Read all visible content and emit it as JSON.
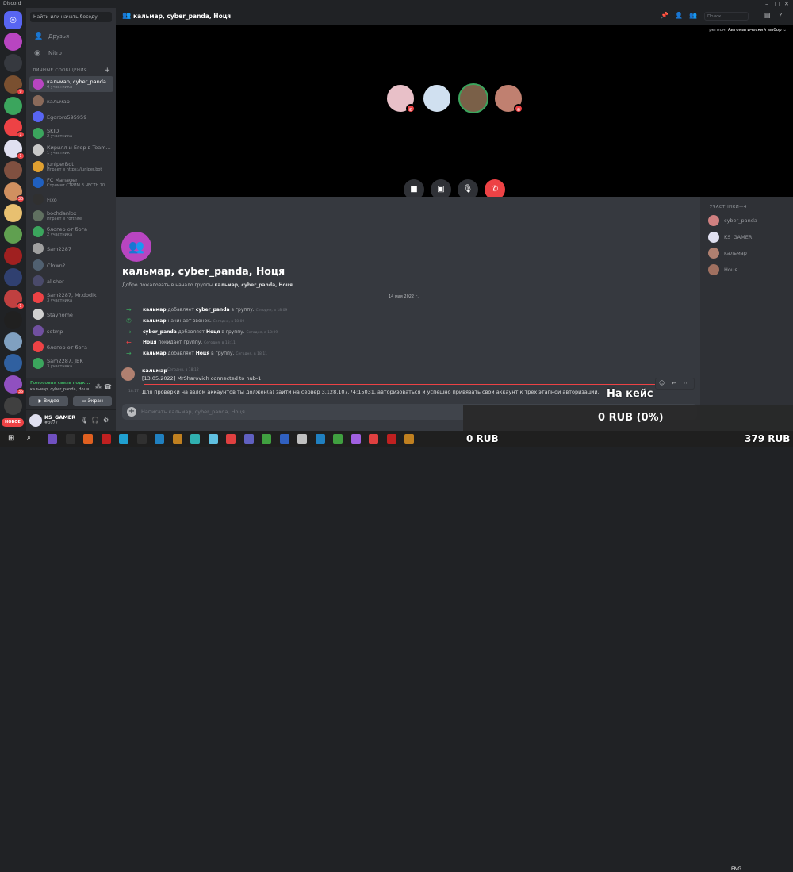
{
  "app": {
    "title": "Discord"
  },
  "dm_sidebar": {
    "search_placeholder": "Найти или начать беседу",
    "nav": [
      {
        "label": "Друзья",
        "icon": "friends-icon"
      },
      {
        "label": "Nitro",
        "icon": "nitro-icon"
      }
    ],
    "section_header": "ЛИЧНЫЕ СООБЩЕНИЯ",
    "dms": [
      {
        "name": "кальмар, cyber_panda...",
        "sub": "4 участника",
        "color": "#b845c1",
        "active": true
      },
      {
        "name": "кальмар",
        "sub": "",
        "color": "#8a6a5a"
      },
      {
        "name": "Egorbro595959",
        "sub": "",
        "color": "#5865f2"
      },
      {
        "name": "SKID",
        "sub": "2 участника",
        "color": "#3ba55d"
      },
      {
        "name": "Кирилл и Егор в Team...",
        "sub": "1 участник",
        "color": "#c8c8c8"
      },
      {
        "name": "JuniperBot",
        "sub": "Играет в https://juniper.bot",
        "color": "#e0a030"
      },
      {
        "name": "FC Manager",
        "sub": "Стримит СТРИМ В ЧЕСТЬ 70...",
        "color": "#2060c0"
      },
      {
        "name": "Fixo",
        "sub": "",
        "color": "#303030"
      },
      {
        "name": "bochdanlox",
        "sub": "Играет в Fortnite",
        "color": "#607060"
      },
      {
        "name": "блогер от бога",
        "sub": "2 участника",
        "color": "#3ba55d"
      },
      {
        "name": "Sam2287",
        "sub": "",
        "color": "#a0a0a0"
      },
      {
        "name": "Clown?",
        "sub": "",
        "color": "#506070"
      },
      {
        "name": "alisher",
        "sub": "",
        "color": "#4a4a6a"
      },
      {
        "name": "Sam2287, Mr.dodik",
        "sub": "3 участника",
        "color": "#ed4245"
      },
      {
        "name": "Stayhome",
        "sub": "",
        "color": "#d0d0d0"
      },
      {
        "name": "setmp",
        "sub": "",
        "color": "#7050a0"
      },
      {
        "name": "блогер от бога",
        "sub": "",
        "color": "#ed4245"
      },
      {
        "name": "Sam2287, JBK",
        "sub": "3 участника",
        "color": "#3ba55d"
      }
    ],
    "voice": {
      "status": "Голосовая связь подк...",
      "channel": "кальмар, cyber_panda, Ноця",
      "video_label": "Видео",
      "screen_label": "Экран"
    },
    "user": {
      "name": "KS_GAMER",
      "tag": "#3077"
    }
  },
  "servers": {
    "badges": [
      "",
      "",
      "",
      "9",
      "",
      "1",
      "1",
      "",
      "30",
      "",
      "",
      "",
      "",
      "1",
      "",
      "",
      "",
      "35",
      ""
    ],
    "new_label": "НОВОЕ"
  },
  "header": {
    "title": "кальмар, cyber_panda, Ноця",
    "search_placeholder": "Поиск"
  },
  "call": {
    "region_label": "регион",
    "region_value": "Автоматический выбор"
  },
  "chat": {
    "welcome_title": "кальмар, cyber_panda, Ноця",
    "welcome_sub_prefix": "Добро пожаловать в начало группы",
    "welcome_sub_names": "кальмар, cyber_panda, Ноця",
    "date": "14 мая 2022 г.",
    "system": [
      {
        "arrow": "→",
        "color": "#3ba55d",
        "actor": "кальмар",
        "action": "добавляет",
        "target": "cyber_panda",
        "suffix": "в группу.",
        "time": "Сегодня, в 18:09"
      },
      {
        "arrow": "✆",
        "color": "#3ba55d",
        "actor": "кальмар",
        "action": "начинает звонок.",
        "target": "",
        "suffix": "",
        "time": "Сегодня, в 18:09"
      },
      {
        "arrow": "→",
        "color": "#3ba55d",
        "actor": "cyber_panda",
        "action": "добавляет",
        "target": "Ноця",
        "suffix": "в группу.",
        "time": "Сегодня, в 18:09"
      },
      {
        "arrow": "←",
        "color": "#ed4245",
        "actor": "Ноця",
        "action": "покидает группу.",
        "target": "",
        "suffix": "",
        "time": "Сегодня, в 18:11"
      },
      {
        "arrow": "→",
        "color": "#3ba55d",
        "actor": "кальмар",
        "action": "добавляет",
        "target": "Ноця",
        "suffix": "в группу.",
        "time": "Сегодня, в 18:11"
      }
    ],
    "message1": {
      "author": "кальмар",
      "time": "Сегодня, в 18:12",
      "text": "[13.05.2022] MrSharovich connected to hub-1"
    },
    "message2": {
      "time": "18:17",
      "text": "Для проверки на взлом аккаунтов ты должен(а) зайти на сервер 3.128.107.74:15031, авторизоваться и успешно привязать свой аккаунт к трёх этапной авторизации."
    },
    "composer_placeholder": "Написать кальмар, cyber_panda, Ноця"
  },
  "members": {
    "header": "УЧАСТНИКИ—4",
    "list": [
      {
        "name": "cyber_panda",
        "color": "#d08080"
      },
      {
        "name": "KS_GAMER",
        "color": "#e0e0f0"
      },
      {
        "name": "кальмар",
        "color": "#b08070"
      },
      {
        "name": "Ноця",
        "color": "#a07060"
      }
    ]
  },
  "overlay": {
    "case_label": "На кейс",
    "progress": "0 RUB (0%)",
    "left_amount": "0 RUB",
    "right_amount": "379 RUB"
  },
  "taskbar": {
    "lang": "ENG"
  }
}
